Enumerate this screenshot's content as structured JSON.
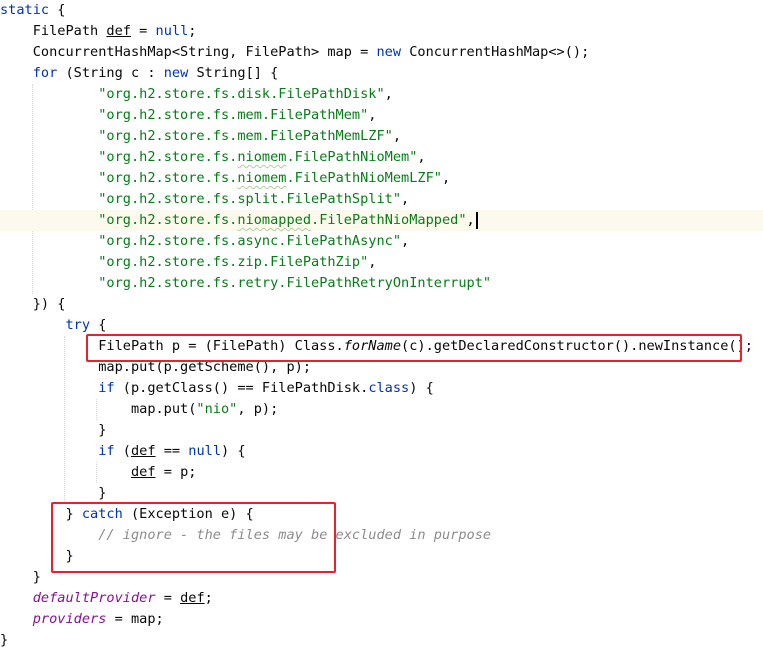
{
  "editor": {
    "lines": [
      {
        "tokens": [
          {
            "t": "static",
            "c": "kw"
          },
          {
            "t": " {"
          }
        ]
      },
      {
        "tokens": [
          {
            "t": "    FilePath "
          },
          {
            "t": "def",
            "c": "ul"
          },
          {
            "t": " = "
          },
          {
            "t": "null",
            "c": "kw"
          },
          {
            "t": ";"
          }
        ]
      },
      {
        "tokens": [
          {
            "t": "    ConcurrentHashMap<String, FilePath> map = "
          },
          {
            "t": "new",
            "c": "kw"
          },
          {
            "t": " ConcurrentHashMap<>();"
          }
        ]
      },
      {
        "tokens": [
          {
            "t": "    "
          },
          {
            "t": "for",
            "c": "kw"
          },
          {
            "t": " (String c : "
          },
          {
            "t": "new",
            "c": "kw"
          },
          {
            "t": " String[] {"
          }
        ]
      },
      {
        "tokens": [
          {
            "t": "            "
          },
          {
            "t": "\"org.h2.store.fs.disk.FilePathDisk\"",
            "c": "str"
          },
          {
            "t": ","
          }
        ]
      },
      {
        "tokens": [
          {
            "t": "            "
          },
          {
            "t": "\"org.h2.store.fs.mem.FilePathMem\"",
            "c": "str"
          },
          {
            "t": ","
          }
        ]
      },
      {
        "tokens": [
          {
            "t": "            "
          },
          {
            "t": "\"org.h2.store.fs.mem.FilePathMemLZF\"",
            "c": "str"
          },
          {
            "t": ","
          }
        ]
      },
      {
        "tokens": [
          {
            "t": "            "
          },
          {
            "t": "\"org.h2.store.fs.",
            "c": "str"
          },
          {
            "t": "niomem",
            "c": "str squig"
          },
          {
            "t": ".FilePathNioMem\"",
            "c": "str"
          },
          {
            "t": ","
          }
        ]
      },
      {
        "tokens": [
          {
            "t": "            "
          },
          {
            "t": "\"org.h2.store.fs.",
            "c": "str"
          },
          {
            "t": "niomem",
            "c": "str squig"
          },
          {
            "t": ".FilePathNioMemLZF\"",
            "c": "str"
          },
          {
            "t": ","
          }
        ]
      },
      {
        "tokens": [
          {
            "t": "            "
          },
          {
            "t": "\"org.h2.store.fs.split.FilePathSplit\"",
            "c": "str"
          },
          {
            "t": ","
          }
        ]
      },
      {
        "tokens": [
          {
            "t": "            "
          },
          {
            "t": "\"org.h2.store.fs.",
            "c": "str"
          },
          {
            "t": "niomapped",
            "c": "str squig"
          },
          {
            "t": ".FilePathNioMapped\"",
            "c": "str"
          },
          {
            "t": ","
          }
        ],
        "current": true
      },
      {
        "tokens": [
          {
            "t": "            "
          },
          {
            "t": "\"org.h2.store.fs.async.FilePathAsync\"",
            "c": "str"
          },
          {
            "t": ","
          }
        ]
      },
      {
        "tokens": [
          {
            "t": "            "
          },
          {
            "t": "\"org.h2.store.fs.zip.FilePathZip\"",
            "c": "str"
          },
          {
            "t": ","
          }
        ]
      },
      {
        "tokens": [
          {
            "t": "            "
          },
          {
            "t": "\"org.h2.store.fs.retry.FilePathRetryOnInterrupt\"",
            "c": "str"
          }
        ]
      },
      {
        "tokens": [
          {
            "t": "    }) {"
          }
        ]
      },
      {
        "tokens": [
          {
            "t": "        "
          },
          {
            "t": "try",
            "c": "kw"
          },
          {
            "t": " {"
          }
        ]
      },
      {
        "tokens": [
          {
            "t": "            FilePath p = (FilePath) Class."
          },
          {
            "t": "forName",
            "c": "it"
          },
          {
            "t": "(c).getDeclaredConstructor().newInstance();"
          }
        ]
      },
      {
        "tokens": [
          {
            "t": "            map.put(p.getScheme(), p);"
          }
        ]
      },
      {
        "tokens": [
          {
            "t": "            "
          },
          {
            "t": "if",
            "c": "kw"
          },
          {
            "t": " (p.getClass() == FilePathDisk."
          },
          {
            "t": "class",
            "c": "kw"
          },
          {
            "t": ") {"
          }
        ]
      },
      {
        "tokens": [
          {
            "t": "                map.put("
          },
          {
            "t": "\"nio\"",
            "c": "str"
          },
          {
            "t": ", p);"
          }
        ]
      },
      {
        "tokens": [
          {
            "t": "            }"
          }
        ]
      },
      {
        "tokens": [
          {
            "t": "            "
          },
          {
            "t": "if",
            "c": "kw"
          },
          {
            "t": " ("
          },
          {
            "t": "def",
            "c": "ul"
          },
          {
            "t": " == "
          },
          {
            "t": "null",
            "c": "kw"
          },
          {
            "t": ") {"
          }
        ]
      },
      {
        "tokens": [
          {
            "t": "                "
          },
          {
            "t": "def",
            "c": "ul"
          },
          {
            "t": " = p;"
          }
        ]
      },
      {
        "tokens": [
          {
            "t": "            }"
          }
        ]
      },
      {
        "tokens": [
          {
            "t": "        } "
          },
          {
            "t": "catch",
            "c": "kw"
          },
          {
            "t": " (Exception e) {"
          }
        ]
      },
      {
        "tokens": [
          {
            "t": "            "
          },
          {
            "t": "// ignore - the files may be excluded in purpose",
            "c": "cm"
          }
        ]
      },
      {
        "tokens": [
          {
            "t": "        }"
          }
        ]
      },
      {
        "tokens": [
          {
            "t": "    }"
          }
        ]
      },
      {
        "tokens": [
          {
            "t": "    "
          },
          {
            "t": "defaultProvider",
            "c": "field"
          },
          {
            "t": " = "
          },
          {
            "t": "def",
            "c": "ul"
          },
          {
            "t": ";"
          }
        ]
      },
      {
        "tokens": [
          {
            "t": "    "
          },
          {
            "t": "providers",
            "c": "field"
          },
          {
            "t": " = map;"
          }
        ]
      },
      {
        "tokens": [
          {
            "t": "}"
          }
        ]
      }
    ]
  },
  "colors": {
    "keyword": "#0033b3",
    "string": "#067d17",
    "comment": "#8c8c8c",
    "field": "#871094",
    "highlight_box": "#e8222a",
    "current_line": "#fcfaed"
  }
}
